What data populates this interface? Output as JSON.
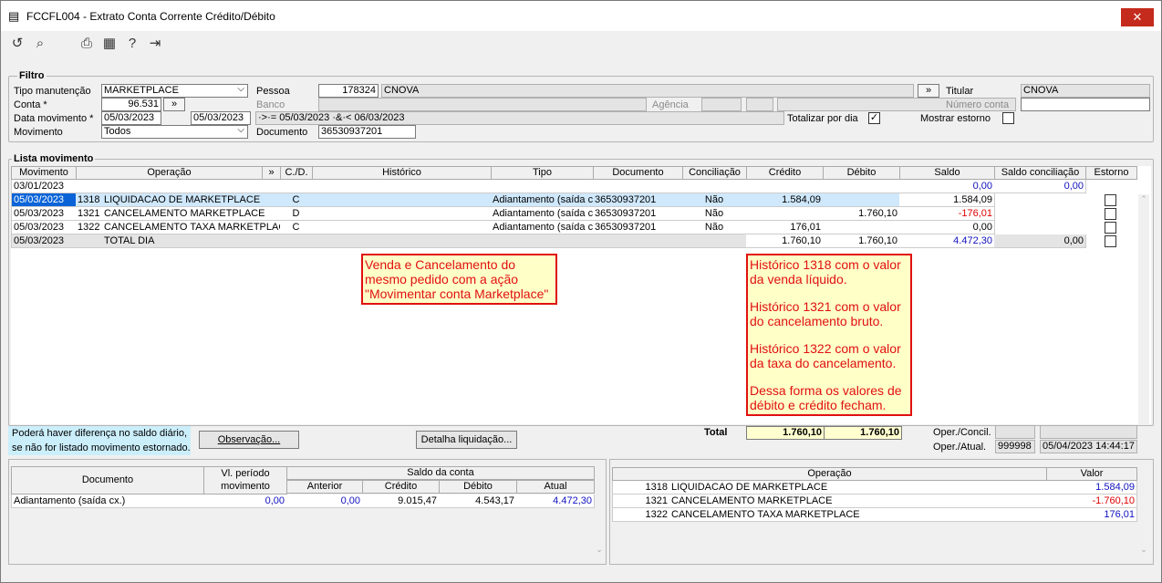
{
  "window": {
    "title": "FCCFL004 - Extrato Conta Corrente Crédito/Débito"
  },
  "filtro": {
    "legend": "Filtro",
    "tipo_manutencao_label": "Tipo manutenção",
    "tipo_manutencao": "MARKETPLACE",
    "conta_label": "Conta *",
    "conta": "96.531",
    "conta_btn": "»",
    "data_mov_label": "Data movimento *",
    "data_ini": "05/03/2023",
    "data_fim": "05/03/2023",
    "data_expr": "·>·= 05/03/2023 ·&·< 06/03/2023",
    "movimento_label": "Movimento",
    "movimento": "Todos",
    "pessoa_label": "Pessoa",
    "pessoa_code": "178324",
    "pessoa_nome": "CNOVA",
    "pessoa_btn": "»",
    "banco_label": "Banco",
    "agencia_label": "Agência",
    "documento_label": "Documento",
    "documento": "36530937201",
    "titular_label": "Titular",
    "titular": "CNOVA",
    "numero_conta_label": "Número conta",
    "totalizar_label": "Totalizar por dia",
    "totalizar_checked": "✓",
    "mostrar_estorno_label": "Mostrar estorno"
  },
  "lista": {
    "legend": "Lista movimento",
    "headers": [
      "Movimento",
      "Operação",
      "»",
      "C./D.",
      "Histórico",
      "Tipo",
      "Documento",
      "Conciliação",
      "Crédito",
      "Débito",
      "Saldo",
      "Saldo conciliação",
      "Estorno"
    ],
    "row0": {
      "date": "03/01/2023",
      "saldo": "0,00",
      "saldo_conc": "0,00"
    },
    "rows": [
      {
        "date": "05/03/2023",
        "code": "1318",
        "op": "LIQUIDACAO DE MARKETPLACE",
        "cd": "C",
        "tipo": "Adiantamento (saída c",
        "doc": "36530937201",
        "conc": "Não",
        "cred": "1.584,09",
        "deb": "",
        "saldo": "1.584,09"
      },
      {
        "date": "05/03/2023",
        "code": "1321",
        "op": "CANCELAMENTO MARKETPLACE",
        "cd": "D",
        "tipo": "Adiantamento (saída c",
        "doc": "36530937201",
        "conc": "Não",
        "cred": "",
        "deb": "1.760,10",
        "saldo": "-176,01"
      },
      {
        "date": "05/03/2023",
        "code": "1322",
        "op": "CANCELAMENTO TAXA MARKETPLACE",
        "cd": "C",
        "tipo": "Adiantamento (saída c",
        "doc": "36530937201",
        "conc": "Não",
        "cred": "176,01",
        "deb": "",
        "saldo": "0,00"
      }
    ],
    "total_row": {
      "date": "05/03/2023",
      "op": "TOTAL DIA",
      "cred": "1.760,10",
      "deb": "1.760,10",
      "saldo": "4.472,30",
      "saldo_conc": "0,00"
    }
  },
  "notes": {
    "left": "Venda e Cancelamento do mesmo pedido com a ação \"Movimentar conta Marketplace\"",
    "right1": "Histórico 1318 com o valor da venda líquido.",
    "right2": "Histórico 1321 com o valor do cancelamento bruto.",
    "right3": "Histórico 1322 com o valor da taxa do cancelamento.",
    "right4": "Dessa forma os valores de débito e crédito fecham."
  },
  "footer": {
    "aviso1": "Poderá haver diferença no saldo diário,",
    "aviso2": "se não for listado movimento estornado.",
    "observacao_btn": "Observação...",
    "detalha_btn": "Detalha liquidação...",
    "total_label": "Total",
    "total_cred": "1.760,10",
    "total_deb": "1.760,10",
    "oper_concil_label": "Oper./Concil.",
    "oper_atual_label": "Oper./Atual.",
    "oper_atual_code": "999998",
    "oper_atual_date": "05/04/2023 14:44:17"
  },
  "doc_table": {
    "h_documento": "Documento",
    "h_vl": "Vl. período movimento",
    "h_saldo": "Saldo da conta",
    "h_anterior": "Anterior",
    "h_credito": "Crédito",
    "h_debito": "Débito",
    "h_atual": "Atual",
    "row": {
      "doc": "Adiantamento (saída cx.)",
      "vl": "0,00",
      "anterior": "0,00",
      "cred": "9.015,47",
      "deb": "4.543,17",
      "atual": "4.472,30"
    }
  },
  "op_table": {
    "h_operacao": "Operação",
    "h_valor": "Valor",
    "rows": [
      {
        "code": "1318",
        "op": "LIQUIDACAO DE MARKETPLACE",
        "valor": "1.584,09"
      },
      {
        "code": "1321",
        "op": "CANCELAMENTO MARKETPLACE",
        "valor": "-1.760,10"
      },
      {
        "code": "1322",
        "op": "CANCELAMENTO TAXA MARKETPLACE",
        "valor": "176,01"
      }
    ]
  }
}
